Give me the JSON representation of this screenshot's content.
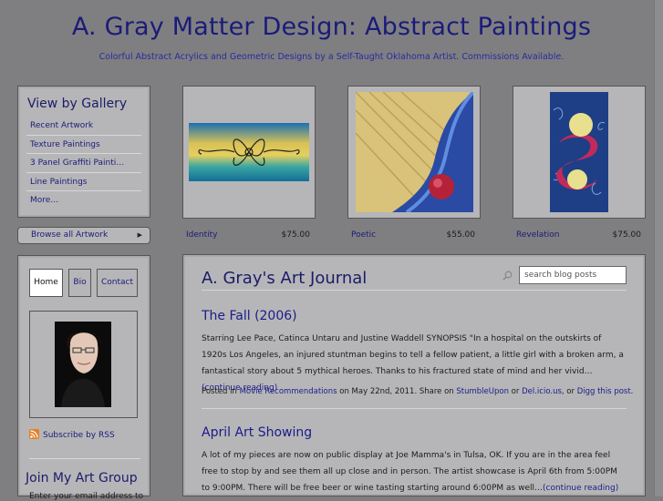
{
  "site": {
    "title": "A. Gray Matter Design: Abstract Paintings",
    "tagline": "Colorful Abstract Acrylics and Geometric Designs by a Self-Taught Oklahoma Artist. Commissions Available."
  },
  "gallery": {
    "heading": "View by Gallery",
    "items": [
      {
        "label": "Recent Artwork"
      },
      {
        "label": "Texture Paintings"
      },
      {
        "label": "3 Panel Graffiti Painti…"
      },
      {
        "label": "Line Paintings"
      },
      {
        "label": "More…"
      }
    ],
    "browse_label": "Browse all Artwork",
    "browse_arrow": "▶"
  },
  "artworks": [
    {
      "title": "Identity",
      "price": "$75.00"
    },
    {
      "title": "Poetic",
      "price": "$55.00"
    },
    {
      "title": "Revelation",
      "price": "$75.00"
    }
  ],
  "nav": {
    "tabs": [
      {
        "label": "Home",
        "active": true
      },
      {
        "label": "Bio"
      },
      {
        "label": "Contact"
      }
    ],
    "rss_label": "Subscribe by RSS",
    "group_heading": "Join My Art Group",
    "group_desc": "Enter your email address to"
  },
  "journal": {
    "title": "A. Gray's Art Journal",
    "search_placeholder": "search blog posts",
    "posts": [
      {
        "title": "The Fall (2006)",
        "body": "Starring Lee Pace, Catinca Untaru and Justine Waddell SYNOPSIS \"In a hospital on the outskirts of 1920s Los Angeles, an injured stuntman begins to tell a fellow patient, a little girl with a broken arm, a fantastical story about 5 mythical heroes. Thanks to his fractured state of mind and her vivid…",
        "more": "(continue reading)",
        "meta_prefix": "Posted in ",
        "category": "Movie Recommendations",
        "meta_date": " on May 22nd, 2011. Share on ",
        "share1": "StumbleUpon",
        "or1": " or ",
        "share2": "Del.icio.us",
        "or2": ", or ",
        "share3": "Digg this post",
        "end": "."
      },
      {
        "title": "April Art Showing",
        "body": "A lot of my pieces are now on public display at Joe Mamma's in Tulsa, OK.  If you are in the area feel free to stop by and see them all up close and in person.  The artist showcase is April 6th from 5:00PM to 9:00PM. There will be free beer or wine tasting starting around 6:00PM as well…",
        "more": "(continue reading)"
      }
    ]
  },
  "colors": {
    "background": "#7f7f81",
    "panel": "#b6b6b8",
    "title_blue": "#1b1b7a",
    "rss_orange": "#e67e22"
  }
}
